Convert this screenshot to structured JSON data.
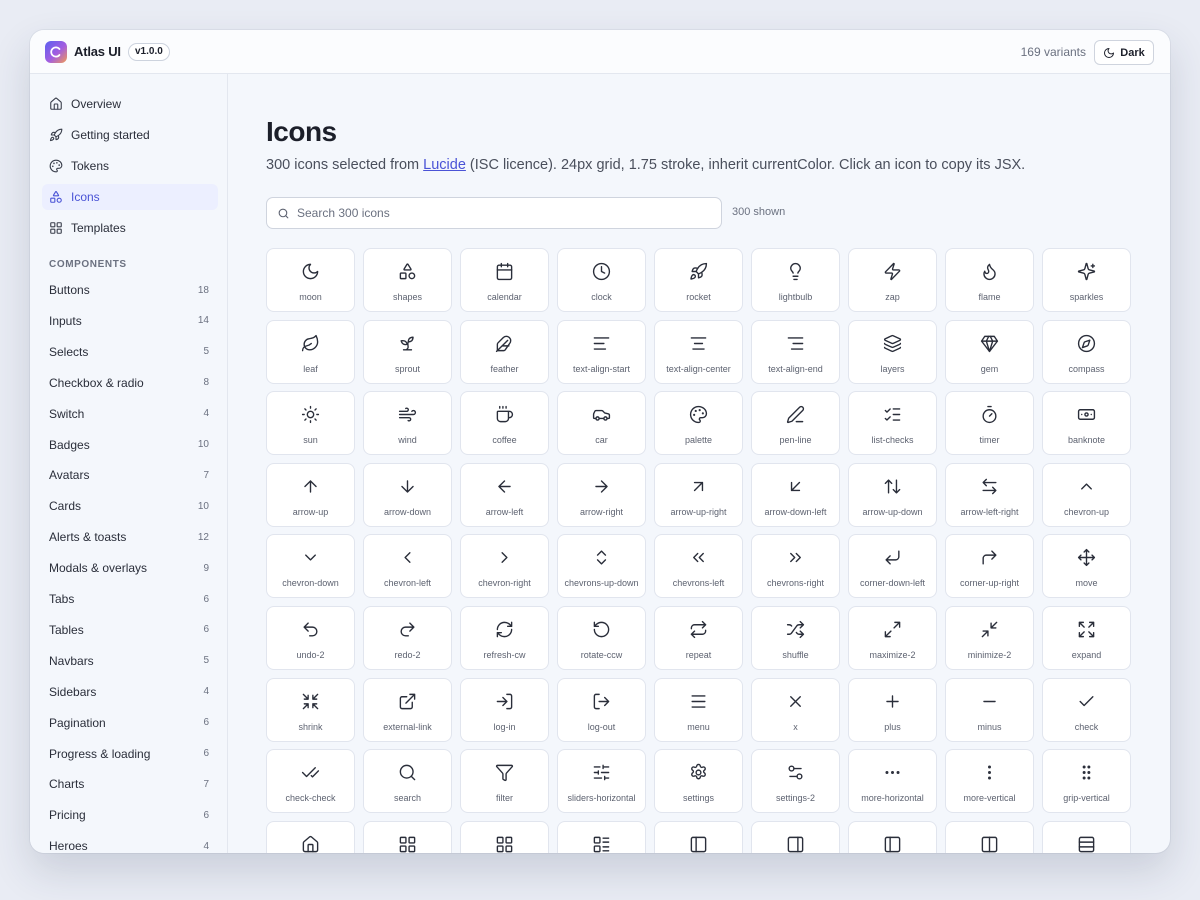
{
  "app": {
    "name": "Atlas UI",
    "version": "v1.0.0",
    "variants": "169 variants",
    "theme_button": "Dark"
  },
  "nav": [
    {
      "label": "Overview",
      "icon": "house-icon"
    },
    {
      "label": "Getting started",
      "icon": "rocket-icon"
    },
    {
      "label": "Tokens",
      "icon": "palette-icon"
    },
    {
      "label": "Icons",
      "icon": "shapes-icon",
      "active": true
    },
    {
      "label": "Templates",
      "icon": "layout-grid-icon"
    }
  ],
  "components_heading": "COMPONENTS",
  "components": [
    {
      "label": "Buttons",
      "count": "18"
    },
    {
      "label": "Inputs",
      "count": "14"
    },
    {
      "label": "Selects",
      "count": "5"
    },
    {
      "label": "Checkbox & radio",
      "count": "8"
    },
    {
      "label": "Switch",
      "count": "4"
    },
    {
      "label": "Badges",
      "count": "10"
    },
    {
      "label": "Avatars",
      "count": "7"
    },
    {
      "label": "Cards",
      "count": "10"
    },
    {
      "label": "Alerts & toasts",
      "count": "12"
    },
    {
      "label": "Modals & overlays",
      "count": "9"
    },
    {
      "label": "Tabs",
      "count": "6"
    },
    {
      "label": "Tables",
      "count": "6"
    },
    {
      "label": "Navbars",
      "count": "5"
    },
    {
      "label": "Sidebars",
      "count": "4"
    },
    {
      "label": "Pagination",
      "count": "6"
    },
    {
      "label": "Progress & loading",
      "count": "6"
    },
    {
      "label": "Charts",
      "count": "7"
    },
    {
      "label": "Pricing",
      "count": "6"
    },
    {
      "label": "Heroes",
      "count": "4"
    }
  ],
  "page": {
    "title": "Icons",
    "desc_before": "300 icons selected from ",
    "desc_link": "Lucide",
    "desc_after": " (ISC licence). 24px grid, 1.75 stroke, inherit currentColor. Click an icon to copy its JSX.",
    "search_placeholder": "Search 300 icons",
    "shown": "300 shown"
  },
  "icons": [
    "moon",
    "shapes",
    "calendar",
    "clock",
    "rocket",
    "lightbulb",
    "zap",
    "flame",
    "sparkles",
    "leaf",
    "sprout",
    "feather",
    "text-align-start",
    "text-align-center",
    "text-align-end",
    "layers",
    "gem",
    "compass",
    "sun",
    "wind",
    "coffee",
    "car",
    "palette",
    "pen-line",
    "list-checks",
    "timer",
    "banknote",
    "arrow-up",
    "arrow-down",
    "arrow-left",
    "arrow-right",
    "arrow-up-right",
    "arrow-down-left",
    "arrow-up-down",
    "arrow-left-right",
    "chevron-up",
    "chevron-down",
    "chevron-left",
    "chevron-right",
    "chevrons-up-down",
    "chevrons-left",
    "chevrons-right",
    "corner-down-left",
    "corner-up-right",
    "move",
    "undo-2",
    "redo-2",
    "refresh-cw",
    "rotate-ccw",
    "repeat",
    "shuffle",
    "maximize-2",
    "minimize-2",
    "expand",
    "shrink",
    "external-link",
    "log-in",
    "log-out",
    "menu",
    "x",
    "plus",
    "minus",
    "check",
    "check-check",
    "search",
    "filter",
    "sliders-horizontal",
    "settings",
    "settings-2",
    "more-horizontal",
    "more-vertical",
    "grip-vertical"
  ],
  "partial_row_icons": [
    "house-icon",
    "layout-grid-icon",
    "grid-icon",
    "layout-list-icon",
    "panel-left-icon",
    "panel-right-icon",
    "panel-left-icon",
    "columns-icon",
    "rows-icon"
  ],
  "colors": {
    "accent": "#4a53d6",
    "background": "#f4f7fc",
    "tile": "#ffffff",
    "border": "#e1e5ee"
  }
}
